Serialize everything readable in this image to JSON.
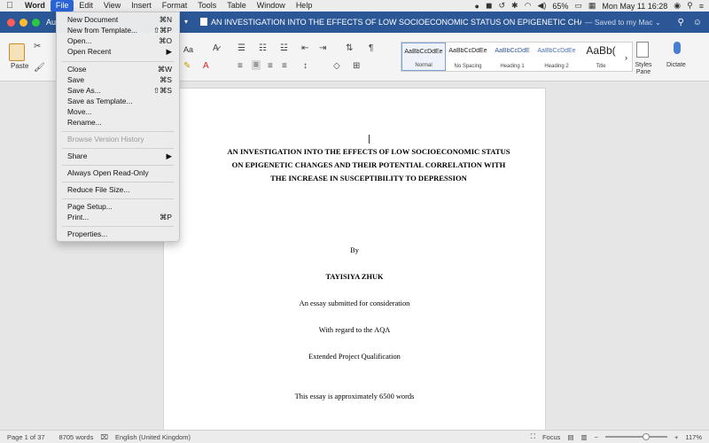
{
  "menubar": {
    "apple": "",
    "app_name": "Word",
    "items": [
      "File",
      "Edit",
      "View",
      "Insert",
      "Format",
      "Tools",
      "Table",
      "Window",
      "Help"
    ],
    "active_item": "File",
    "battery": "65%",
    "clock": "Mon May 11  16:28"
  },
  "window": {
    "title_prefix": "Au",
    "doc_title": "AN INVESTIGATION INTO THE EFFECTS OF LOW SOCIOECONOMIC STATUS ON EPIGENETIC CHANGES AND T...",
    "saved_status": "— Saved to my Mac ⌄",
    "lights": [
      "#ff5f57",
      "#febc2e",
      "#28c840"
    ]
  },
  "ribbon": {
    "paste_label": "Paste",
    "font_size_label": "Aa",
    "styles": [
      {
        "sample": "AaBbCcDdEe",
        "name": "Normal"
      },
      {
        "sample": "AaBbCcDdEe",
        "name": "No Spacing"
      },
      {
        "sample": "AaBbCcDdE",
        "name": "Heading 1"
      },
      {
        "sample": "AaBbCcDdEe",
        "name": "Heading 2"
      },
      {
        "sample": "AaBb(",
        "name": "Title"
      }
    ],
    "styles_pane_label": "Styles\nPane",
    "dictate_label": "Dictate"
  },
  "file_menu": {
    "items": [
      {
        "label": "New Document",
        "shortcut": "⌘N"
      },
      {
        "label": "New from Template...",
        "shortcut": "⇧⌘P"
      },
      {
        "label": "Open...",
        "shortcut": "⌘O"
      },
      {
        "label": "Open Recent",
        "shortcut": "▶"
      },
      {
        "label": "Close",
        "shortcut": "⌘W"
      },
      {
        "label": "Save",
        "shortcut": "⌘S"
      },
      {
        "label": "Save As...",
        "shortcut": "⇧⌘S"
      },
      {
        "label": "Save as Template...",
        "shortcut": ""
      },
      {
        "label": "Move...",
        "shortcut": ""
      },
      {
        "label": "Rename...",
        "shortcut": ""
      },
      {
        "label": "Browse Version History",
        "shortcut": "",
        "disabled": true
      },
      {
        "label": "Share",
        "shortcut": "▶"
      },
      {
        "label": "Always Open Read-Only",
        "shortcut": ""
      },
      {
        "label": "Reduce File Size...",
        "shortcut": ""
      },
      {
        "label": "Page Setup...",
        "shortcut": ""
      },
      {
        "label": "Print...",
        "shortcut": "⌘P"
      },
      {
        "label": "Properties...",
        "shortcut": ""
      }
    ]
  },
  "document": {
    "title": "AN INVESTIGATION INTO THE EFFECTS OF LOW SOCIOECONOMIC STATUS ON EPIGENETIC CHANGES AND THEIR POTENTIAL CORRELATION WITH THE INCREASE IN SUSCEPTIBILITY TO DEPRESSION",
    "by": "By",
    "author": "TAYISIYA ZHUK",
    "line1": "An essay submitted for consideration",
    "line2": "With regard to the AQA",
    "line3": "Extended Project Qualification",
    "line4": "This essay is approximately 6500 words"
  },
  "statusbar": {
    "page": "Page 1 of 37",
    "words": "8705 words",
    "language": "English (United Kingdom)",
    "focus": "Focus",
    "zoom": "117%",
    "zoom_fraction": 0.6
  }
}
